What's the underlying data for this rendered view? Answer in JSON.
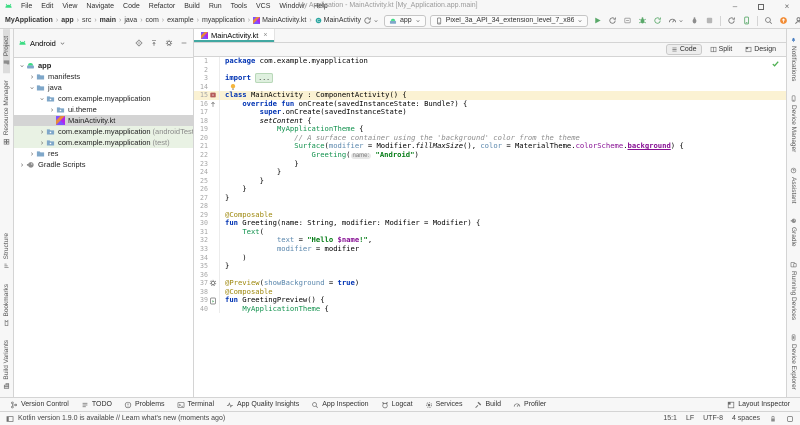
{
  "title_bar": {
    "menus": [
      "File",
      "Edit",
      "View",
      "Navigate",
      "Code",
      "Refactor",
      "Build",
      "Run",
      "Tools",
      "VCS",
      "Window",
      "Help"
    ],
    "title": "My Application - MainActivity.kt [My_Application.app.main]",
    "window_controls": [
      {
        "name": "minimize",
        "glyph": "–"
      },
      {
        "name": "maximize",
        "glyph": ""
      },
      {
        "name": "close",
        "glyph": "×"
      }
    ]
  },
  "breadcrumbs": [
    {
      "label": "MyApplication",
      "bold": true
    },
    {
      "label": "app",
      "bold": true
    },
    {
      "label": "src"
    },
    {
      "label": "main",
      "bold": true
    },
    {
      "label": "java"
    },
    {
      "label": "com"
    },
    {
      "label": "example"
    },
    {
      "label": "myapplication"
    },
    {
      "label": "MainActivity.kt",
      "icon": "kotlin"
    },
    {
      "label": "MainActivity",
      "icon": "class"
    }
  ],
  "run_toolbar": {
    "run_config": "app",
    "device": "Pixel_3a_API_34_extension_level_7_x86...",
    "actions": [
      "run",
      "apply-changes",
      "restart-activity",
      "debug",
      "apply-code-changes",
      "profiler",
      "attach-debugger",
      "stop",
      "sep",
      "sync-project",
      "device-manager",
      "sep",
      "search",
      "available-updates",
      "profile"
    ]
  },
  "left_stripe": {
    "top": [
      {
        "label": "Project",
        "icon": "project",
        "active": true
      },
      {
        "label": "Resource Manager",
        "icon": "resource-manager"
      }
    ],
    "bottom": [
      {
        "label": "Structure",
        "icon": "structure"
      },
      {
        "label": "Bookmarks",
        "icon": "bookmarks"
      },
      {
        "label": "Build Variants",
        "icon": "build-variants"
      }
    ]
  },
  "right_stripe": {
    "top": [
      {
        "label": "Notifications",
        "icon": "bell"
      },
      {
        "label": "Device Manager",
        "icon": "phone-gray"
      },
      {
        "label": "Assistant",
        "icon": "assistant"
      },
      {
        "label": "Gradle",
        "icon": "gradle"
      }
    ],
    "bottom": [
      {
        "label": "Running Devices",
        "icon": "running-devices"
      },
      {
        "label": "Device Explorer",
        "icon": "device-explorer"
      }
    ]
  },
  "project_panel": {
    "selector": "Android",
    "header_actions": [
      "locate-file",
      "collapse-all",
      "settings",
      "hide"
    ],
    "tree": [
      {
        "label": "app",
        "depth": 0,
        "icon": "app-module",
        "state": "open",
        "bold": true
      },
      {
        "label": "manifests",
        "depth": 1,
        "icon": "folder",
        "state": "closed"
      },
      {
        "label": "java",
        "depth": 1,
        "icon": "folder",
        "state": "open"
      },
      {
        "label": "com.example.myapplication",
        "depth": 2,
        "icon": "package",
        "state": "open"
      },
      {
        "label": "ui.theme",
        "depth": 3,
        "icon": "package",
        "state": "closed"
      },
      {
        "label": "MainActivity.kt",
        "depth": 3,
        "icon": "kotlin",
        "state": "leaf",
        "selected": true
      },
      {
        "label": "com.example.myapplication",
        "suffix": "(androidTest)",
        "depth": 2,
        "icon": "package",
        "state": "closed",
        "tint": "green"
      },
      {
        "label": "com.example.myapplication",
        "suffix": "(test)",
        "depth": 2,
        "icon": "package",
        "state": "closed",
        "tint": "green"
      },
      {
        "label": "res",
        "depth": 1,
        "icon": "folder",
        "state": "closed"
      },
      {
        "label": "Gradle Scripts",
        "depth": 0,
        "icon": "gradle",
        "state": "closed"
      }
    ]
  },
  "editor": {
    "tab": {
      "label": "MainActivity.kt",
      "icon": "kotlin",
      "close": "×"
    },
    "modes": [
      {
        "label": "Code",
        "icon": "mode-code",
        "active": true
      },
      {
        "label": "Split",
        "icon": "mode-split"
      },
      {
        "label": "Design",
        "icon": "mode-design"
      }
    ],
    "lines": [
      {
        "n": "1",
        "segs": [
          [
            "package",
            "kw"
          ],
          [
            " com.example.myapplication",
            "pl"
          ]
        ]
      },
      {
        "n": "2"
      },
      {
        "n": "3",
        "segs": [
          [
            "import",
            "kw"
          ],
          [
            " ",
            "pl"
          ],
          [
            "...",
            "fold"
          ]
        ]
      },
      {
        "n": "14",
        "bulb": true
      },
      {
        "n": "15",
        "caret": true,
        "gutter": "activity-marker",
        "segs": [
          [
            "class",
            "kw"
          ],
          [
            " MainActivity : ComponentActivity() {",
            "pl"
          ]
        ]
      },
      {
        "n": "16",
        "gutter": "override",
        "segs": [
          [
            "    ",
            "pl"
          ],
          [
            "override",
            "kw"
          ],
          [
            " ",
            "pl"
          ],
          [
            "fun",
            "kw"
          ],
          [
            " onCreate(savedInstanceState: Bundle?) {",
            "pl"
          ]
        ]
      },
      {
        "n": "17",
        "segs": [
          [
            "        ",
            "pl"
          ],
          [
            "super",
            "kw"
          ],
          [
            ".onCreate(savedInstanceState)",
            "pl"
          ]
        ]
      },
      {
        "n": "18",
        "segs": [
          [
            "        ",
            "pl"
          ],
          [
            "setContent",
            "ext"
          ],
          [
            " {",
            "pl"
          ]
        ]
      },
      {
        "n": "19",
        "segs": [
          [
            "            ",
            "pl"
          ],
          [
            "MyApplicationTheme",
            "fc"
          ],
          [
            " {",
            "pl"
          ]
        ]
      },
      {
        "n": "20",
        "segs": [
          [
            "                ",
            "pl"
          ],
          [
            "// A surface container using the 'background' color from the theme",
            "cm"
          ]
        ]
      },
      {
        "n": "21",
        "segs": [
          [
            "                ",
            "pl"
          ],
          [
            "Surface",
            "fc"
          ],
          [
            "(",
            "pl"
          ],
          [
            "modifier",
            "na"
          ],
          [
            " = Modifier.",
            "pl"
          ],
          [
            "fillMaxSize",
            "ext"
          ],
          [
            "(), ",
            "pl"
          ],
          [
            "color",
            "na"
          ],
          [
            " = MaterialTheme.",
            "pl"
          ],
          [
            "colorScheme",
            "pr"
          ],
          [
            ".",
            "pl"
          ],
          [
            "background",
            "prl"
          ],
          [
            ") {",
            "pl"
          ]
        ]
      },
      {
        "n": "22",
        "segs": [
          [
            "                    ",
            "pl"
          ],
          [
            "Greeting",
            "fc"
          ],
          [
            "(",
            "pl"
          ],
          [
            "name:",
            "hint"
          ],
          [
            " ",
            "pl"
          ],
          [
            "\"Android\"",
            "st"
          ],
          [
            ")",
            "pl"
          ]
        ]
      },
      {
        "n": "23",
        "segs": [
          [
            "                }",
            "pl"
          ]
        ]
      },
      {
        "n": "24",
        "segs": [
          [
            "            }",
            "pl"
          ]
        ]
      },
      {
        "n": "25",
        "segs": [
          [
            "        }",
            "pl"
          ]
        ]
      },
      {
        "n": "26",
        "segs": [
          [
            "    }",
            "pl"
          ]
        ]
      },
      {
        "n": "27",
        "segs": [
          [
            "}",
            "pl"
          ]
        ]
      },
      {
        "n": "28"
      },
      {
        "n": "29",
        "segs": [
          [
            "@Composable",
            "an"
          ]
        ]
      },
      {
        "n": "30",
        "segs": [
          [
            "fun",
            "kw"
          ],
          [
            " Greeting(name: String, modifier: Modifier = Modifier) {",
            "pl"
          ]
        ]
      },
      {
        "n": "31",
        "segs": [
          [
            "    ",
            "pl"
          ],
          [
            "Text",
            "fc"
          ],
          [
            "(",
            "pl"
          ]
        ]
      },
      {
        "n": "32",
        "segs": [
          [
            "            ",
            "pl"
          ],
          [
            "text",
            "na"
          ],
          [
            " = ",
            "pl"
          ],
          [
            "\"Hello ",
            "st"
          ],
          [
            "$name",
            "tpl"
          ],
          [
            "!\"",
            "st"
          ],
          [
            ",",
            "pl"
          ]
        ]
      },
      {
        "n": "33",
        "segs": [
          [
            "            ",
            "pl"
          ],
          [
            "modifier",
            "na"
          ],
          [
            " = modifier",
            "pl"
          ]
        ]
      },
      {
        "n": "34",
        "segs": [
          [
            "    )",
            "pl"
          ]
        ]
      },
      {
        "n": "35",
        "segs": [
          [
            "}",
            "pl"
          ]
        ]
      },
      {
        "n": "36"
      },
      {
        "n": "37",
        "gutter": "gear",
        "segs": [
          [
            "@Preview",
            "an"
          ],
          [
            "(",
            "pl"
          ],
          [
            "showBackground",
            "na"
          ],
          [
            " = ",
            "pl"
          ],
          [
            "true",
            "kw"
          ],
          [
            ")",
            "pl"
          ]
        ]
      },
      {
        "n": "38",
        "segs": [
          [
            "@Composable",
            "an"
          ]
        ]
      },
      {
        "n": "39",
        "gutter": "run-preview",
        "segs": [
          [
            "fun",
            "kw"
          ],
          [
            " GreetingPreview() {",
            "pl"
          ]
        ]
      },
      {
        "n": "40",
        "segs": [
          [
            "    ",
            "pl"
          ],
          [
            "MyApplicationTheme",
            "fc"
          ],
          [
            " {",
            "pl"
          ]
        ]
      }
    ]
  },
  "bottom_bar": {
    "left": [
      {
        "label": "Version Control",
        "icon": "branch"
      },
      {
        "label": "TODO",
        "icon": "todo"
      },
      {
        "label": "Problems",
        "icon": "problems"
      },
      {
        "label": "Terminal",
        "icon": "terminal"
      },
      {
        "label": "App Quality Insights",
        "icon": "insights"
      },
      {
        "label": "App Inspection",
        "icon": "inspection"
      },
      {
        "label": "Logcat",
        "icon": "logcat"
      },
      {
        "label": "Services",
        "icon": "services"
      },
      {
        "label": "Build",
        "icon": "build"
      },
      {
        "label": "Profiler",
        "icon": "profiler-sm"
      }
    ],
    "right": [
      {
        "label": "Layout Inspector",
        "icon": "layout-inspector"
      }
    ]
  },
  "status_bar": {
    "message": "Kotlin version 1.9.0 is available // Learn what's new (moments ago)",
    "position": "15:1",
    "line_separator": "LF",
    "encoding": "UTF-8",
    "indent": "4 spaces"
  }
}
